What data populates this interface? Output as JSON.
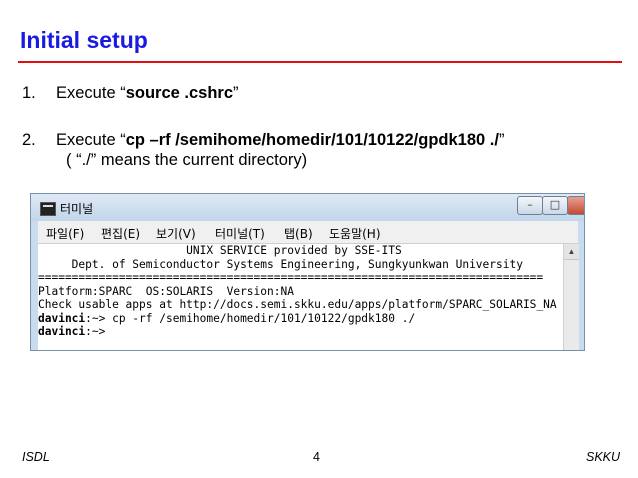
{
  "slide": {
    "title": "Initial setup",
    "accent_color": "#1a1ae0",
    "rule_color": "#e01010"
  },
  "bullets": [
    {
      "num": "1.",
      "prefix": "Execute “",
      "cmd": "source  .cshrc",
      "suffix": "”"
    },
    {
      "num": "2.",
      "prefix": "Execute  “",
      "cmd": "cp  –rf  /semihome/homedir/101/10122/gpdk180  ./",
      "suffix": "”",
      "note": "( “./” means the current directory)"
    }
  ],
  "terminal": {
    "window_title": "터미널",
    "icon": "terminal-icon",
    "buttons": {
      "minimize": "–",
      "maximize": "□",
      "close": "x"
    },
    "menu": [
      "파일(F)",
      "편집(E)",
      "보기(V)",
      "터미널(T)",
      "탭(B)",
      "도움말(H)"
    ],
    "lines": [
      {
        "text": "                      UNIX SERVICE provided by SSE-ITS"
      },
      {
        "text": "     Dept. of Semiconductor Systems Engineering, Sungkyunkwan University"
      },
      {
        "text": "==========================================================================="
      },
      {
        "text": "Platform:SPARC  OS:SOLARIS  Version:NA"
      },
      {
        "text": "Check usable apps at http://docs.semi.skku.edu/apps/platform/SPARC_SOLARIS_NA"
      },
      {
        "prompt": "davinci",
        "text": ":~> cp -rf /semihome/homedir/101/10122/gpdk180 ./"
      },
      {
        "prompt": "davinci",
        "text": ":~>"
      }
    ]
  },
  "footer": {
    "left": "ISDL",
    "page": "4",
    "right": "SKKU"
  }
}
